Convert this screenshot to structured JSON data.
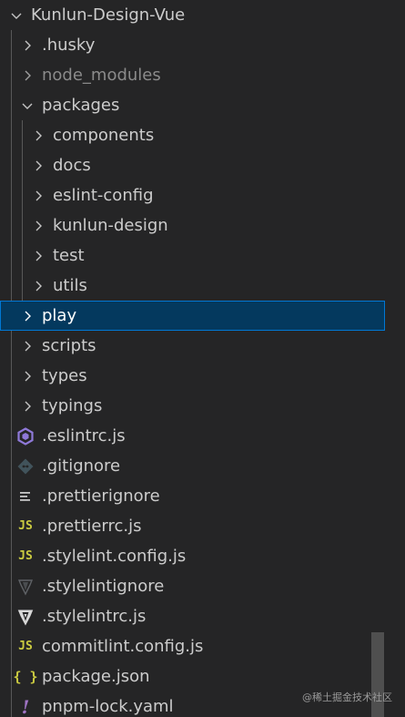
{
  "explorer": {
    "root": {
      "label": "Kunlun-Design-Vue",
      "icon": "chevron-down-icon"
    },
    "items": [
      {
        "label": ".husky",
        "kind": "folder",
        "icon": "chevron-right-icon"
      },
      {
        "label": "node_modules",
        "kind": "folder",
        "icon": "chevron-right-icon",
        "dimmed": true
      },
      {
        "label": "packages",
        "kind": "folder",
        "icon": "chevron-down-icon",
        "expanded": true
      },
      {
        "label": "components",
        "kind": "folder",
        "icon": "chevron-right-icon"
      },
      {
        "label": "docs",
        "kind": "folder",
        "icon": "chevron-right-icon"
      },
      {
        "label": "eslint-config",
        "kind": "folder",
        "icon": "chevron-right-icon"
      },
      {
        "label": "kunlun-design",
        "kind": "folder",
        "icon": "chevron-right-icon"
      },
      {
        "label": "test",
        "kind": "folder",
        "icon": "chevron-right-icon"
      },
      {
        "label": "utils",
        "kind": "folder",
        "icon": "chevron-right-icon"
      },
      {
        "label": "play",
        "kind": "folder",
        "icon": "chevron-right-icon",
        "selected": true
      },
      {
        "label": "scripts",
        "kind": "folder",
        "icon": "chevron-right-icon"
      },
      {
        "label": "types",
        "kind": "folder",
        "icon": "chevron-right-icon"
      },
      {
        "label": "typings",
        "kind": "folder",
        "icon": "chevron-right-icon"
      },
      {
        "label": ".eslintrc.js",
        "kind": "file",
        "icon": "eslint-icon"
      },
      {
        "label": ".gitignore",
        "kind": "file",
        "icon": "git-icon"
      },
      {
        "label": ".prettierignore",
        "kind": "file",
        "icon": "lines-icon"
      },
      {
        "label": ".prettierrc.js",
        "kind": "file",
        "icon": "js-icon",
        "glyph": "JS"
      },
      {
        "label": ".stylelint.config.js",
        "kind": "file",
        "icon": "js-icon",
        "glyph": "JS"
      },
      {
        "label": ".stylelintignore",
        "kind": "file",
        "icon": "stylelint-dim-icon"
      },
      {
        "label": ".stylelintrc.js",
        "kind": "file",
        "icon": "stylelint-icon"
      },
      {
        "label": "commitlint.config.js",
        "kind": "file",
        "icon": "js-icon",
        "glyph": "JS"
      },
      {
        "label": "package.json",
        "kind": "file",
        "icon": "json-icon",
        "glyph": "{ }"
      },
      {
        "label": "pnpm-lock.yaml",
        "kind": "file",
        "icon": "yaml-icon",
        "glyph": "!"
      }
    ]
  },
  "watermark": "@稀土掘金技术社区",
  "colors": {
    "background": "#252526",
    "selected_bg": "#04395e",
    "selected_border": "#0078d4",
    "text": "#cccccc",
    "dim_text": "#8b8b8b",
    "js": "#cbcb41",
    "eslint": "#8f79d8",
    "git": "#41535b",
    "yaml": "#a074c4"
  }
}
